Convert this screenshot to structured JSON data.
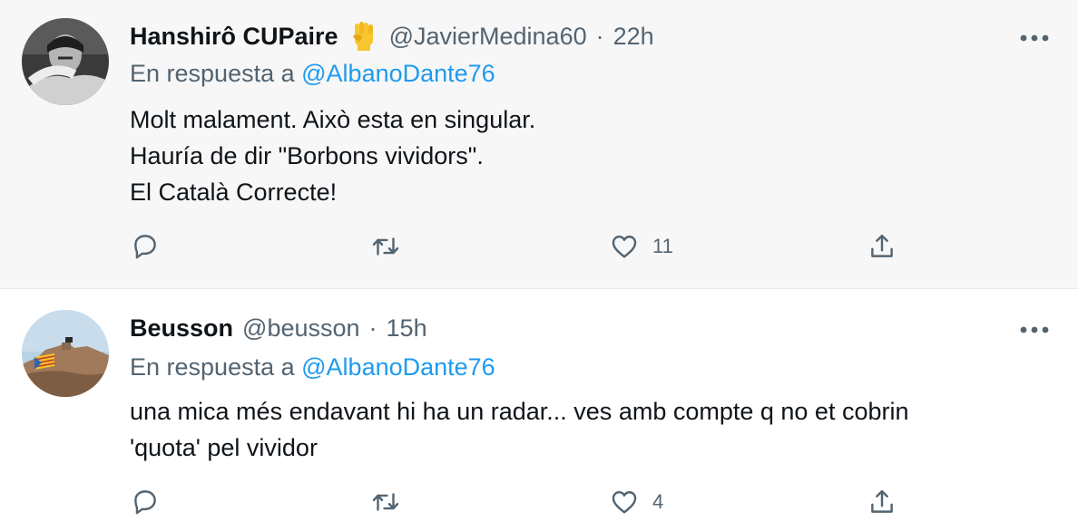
{
  "tweets": [
    {
      "display_name": "Hanshirô CUPaire",
      "badge_icon": "raised-fist-emoji",
      "handle": "@JavierMedina60",
      "separator": "·",
      "time": "22h",
      "reply_prefix": "En respuesta a",
      "reply_to": "@AlbanoDante76",
      "lines": [
        "Molt malament. Això esta en singular.",
        "Hauría de dir \"Borbons vividors\".",
        "El Català Correcte!"
      ],
      "actions": {
        "reply_count": "",
        "retweet_count": "",
        "like_count": "11"
      }
    },
    {
      "display_name": "Beusson",
      "handle": "@beusson",
      "separator": "·",
      "time": "15h",
      "reply_prefix": "En respuesta a",
      "reply_to": "@AlbanoDante76",
      "lines": [
        "una mica més endavant hi ha un radar... ves amb compte q no et cobrin",
        "'quota' pel vividor"
      ],
      "actions": {
        "reply_count": "",
        "retweet_count": "",
        "like_count": "4"
      }
    }
  ],
  "colors": {
    "link": "#1d9bf0",
    "secondary_text": "#536471",
    "primary_text": "#0f1419",
    "highlight_bg": "#f7f7f7",
    "emoji_yellow": "#f7c52f"
  }
}
